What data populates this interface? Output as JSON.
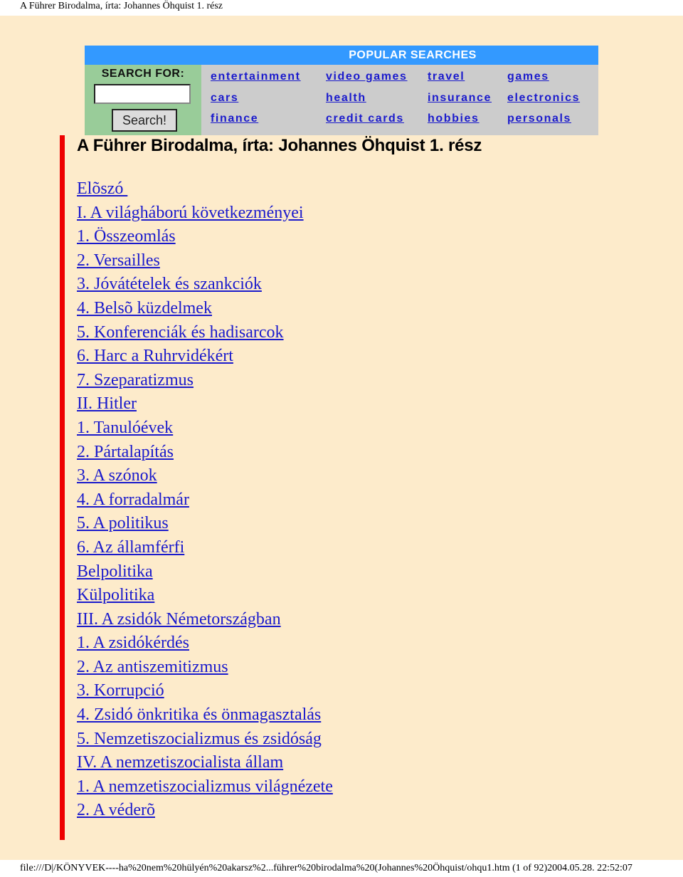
{
  "print_header": {
    "title": "A Führer Birodalma, írta: Johannes Öhquist 1. rész"
  },
  "search_widget": {
    "header": "POPULAR SEARCHES",
    "search_label": "SEARCH FOR:",
    "search_input_value": "",
    "search_button_label": "Search!",
    "links": [
      [
        "entertainment",
        "video games",
        "travel",
        "games"
      ],
      [
        "cars",
        "health",
        "insurance",
        "electronics"
      ],
      [
        "finance",
        "credit cards",
        "hobbies",
        "personals"
      ]
    ],
    "colors": {
      "header_bg": "#3399ff",
      "search_panel_bg": "#99cc99",
      "links_panel_bg": "#cccccc",
      "link": "#1a1acc"
    }
  },
  "document": {
    "title": "A Führer Birodalma, írta: Johannes Öhquist 1. rész",
    "toc": [
      "Elõszó ",
      "I. A világháború következményei",
      "1. Összeomlás",
      "2. Versailles",
      "3. Jóvátételek és szankciók",
      "4. Belsõ küzdelmek",
      "5. Konferenciák és hadisarcok",
      "6. Harc a Ruhrvidékért",
      "7. Szeparatizmus",
      "II. Hitler",
      "1. Tanulóévek",
      "2. Pártalapítás",
      "3. A szónok",
      "4. A forradalmár",
      "5. A politikus",
      "6. Az államférfi",
      "Belpolitika",
      "Külpolitika",
      "III. A zsidók Németországban",
      "1. A zsidókérdés",
      "2. Az antiszemitizmus",
      "3. Korrupció",
      "4. Zsidó önkritika és önmagasztalás",
      "5. Nemzetiszocializmus és zsidóság",
      "IV. A nemzetiszocialista állam",
      "1. A nemzetiszocializmus világnézete",
      "2. A véderõ"
    ],
    "colors": {
      "page_bg": "#fdebcb",
      "accent_bar": "#ee0000",
      "link": "#1a1acc"
    }
  },
  "print_footer": {
    "text": "file:///D|/KÖNYVEK----ha%20nem%20hülyén%20akarsz%2...führer%20birodalma%20(Johannes%20Öhquist/ohqu1.htm (1 of 92)2004.05.28. 22:52:07"
  }
}
